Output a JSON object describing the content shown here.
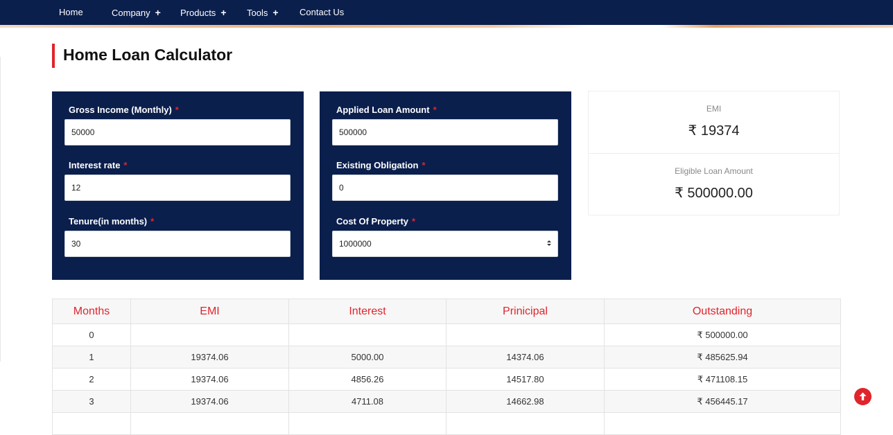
{
  "nav": {
    "items": [
      {
        "label": "Home",
        "has_submenu": false
      },
      {
        "label": "Company",
        "has_submenu": true
      },
      {
        "label": "Products",
        "has_submenu": true
      },
      {
        "label": "Tools",
        "has_submenu": true
      },
      {
        "label": "Contact Us",
        "has_submenu": false
      }
    ],
    "submenu_glyph": "+"
  },
  "page": {
    "title": "Home Loan Calculator"
  },
  "form": {
    "required_mark": "*",
    "gross_income": {
      "label": "Gross Income (Monthly)",
      "value": "50000"
    },
    "interest_rate": {
      "label": "Interest rate",
      "value": "12"
    },
    "tenure": {
      "label": "Tenure(in months)",
      "value": "30"
    },
    "applied_loan": {
      "label": "Applied Loan Amount",
      "value": "500000"
    },
    "existing_obligation": {
      "label": "Existing Obligation",
      "value": "0"
    },
    "cost_of_property": {
      "label": "Cost Of Property",
      "value": "1000000"
    }
  },
  "results": {
    "emi_label": "EMI",
    "emi_value": "₹ 19374",
    "eligible_label": "Eligible Loan Amount",
    "eligible_value": "₹ 500000.00"
  },
  "schedule": {
    "headers": [
      "Months",
      "EMI",
      "Interest",
      "Prinicipal",
      "Outstanding"
    ],
    "rows": [
      [
        "0",
        "",
        "",
        "",
        "₹ 500000.00"
      ],
      [
        "1",
        "19374.06",
        "5000.00",
        "14374.06",
        "₹ 485625.94"
      ],
      [
        "2",
        "19374.06",
        "4856.26",
        "14517.80",
        "₹ 471108.15"
      ],
      [
        "3",
        "19374.06",
        "4711.08",
        "14662.98",
        "₹ 456445.17"
      ],
      [
        "",
        "",
        "",
        "",
        ""
      ]
    ]
  },
  "icons": {
    "scroll_top": "arrow-up-circle-icon",
    "number_spinner": "up-down-spinner-icon"
  },
  "colors": {
    "navy": "#0b1f4d",
    "accent_red": "#e0242b"
  }
}
